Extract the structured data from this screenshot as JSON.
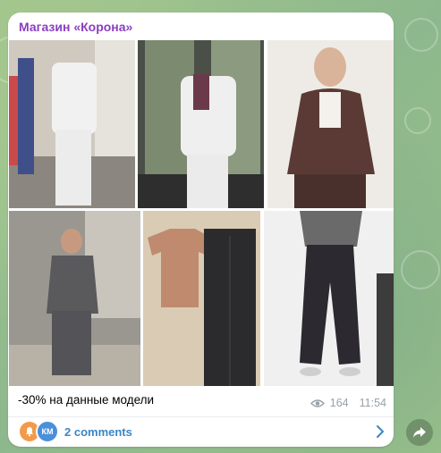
{
  "post": {
    "channel_name": "Магазин «Корона»",
    "caption": "-30% на данные модели",
    "views": "164",
    "time": "11:54",
    "comments_label": "2 comments",
    "avatar_initials": "КМ"
  },
  "photos": [
    {
      "name": "photo-white-tracksuit-showroom"
    },
    {
      "name": "photo-white-tracksuit-mannequin"
    },
    {
      "name": "photo-brown-quilted-jacket"
    },
    {
      "name": "photo-grey-tracksuit-model"
    },
    {
      "name": "photo-tee-and-black-pants"
    },
    {
      "name": "photo-grey-sweater-black-pants"
    }
  ],
  "icons": [
    "eye-icon",
    "chevron-right-icon",
    "share-icon",
    "bell-avatar-icon"
  ],
  "colors": {
    "channel_name": "#8a3fbf",
    "link": "#3a86c6",
    "meta": "#9aa1a7"
  }
}
